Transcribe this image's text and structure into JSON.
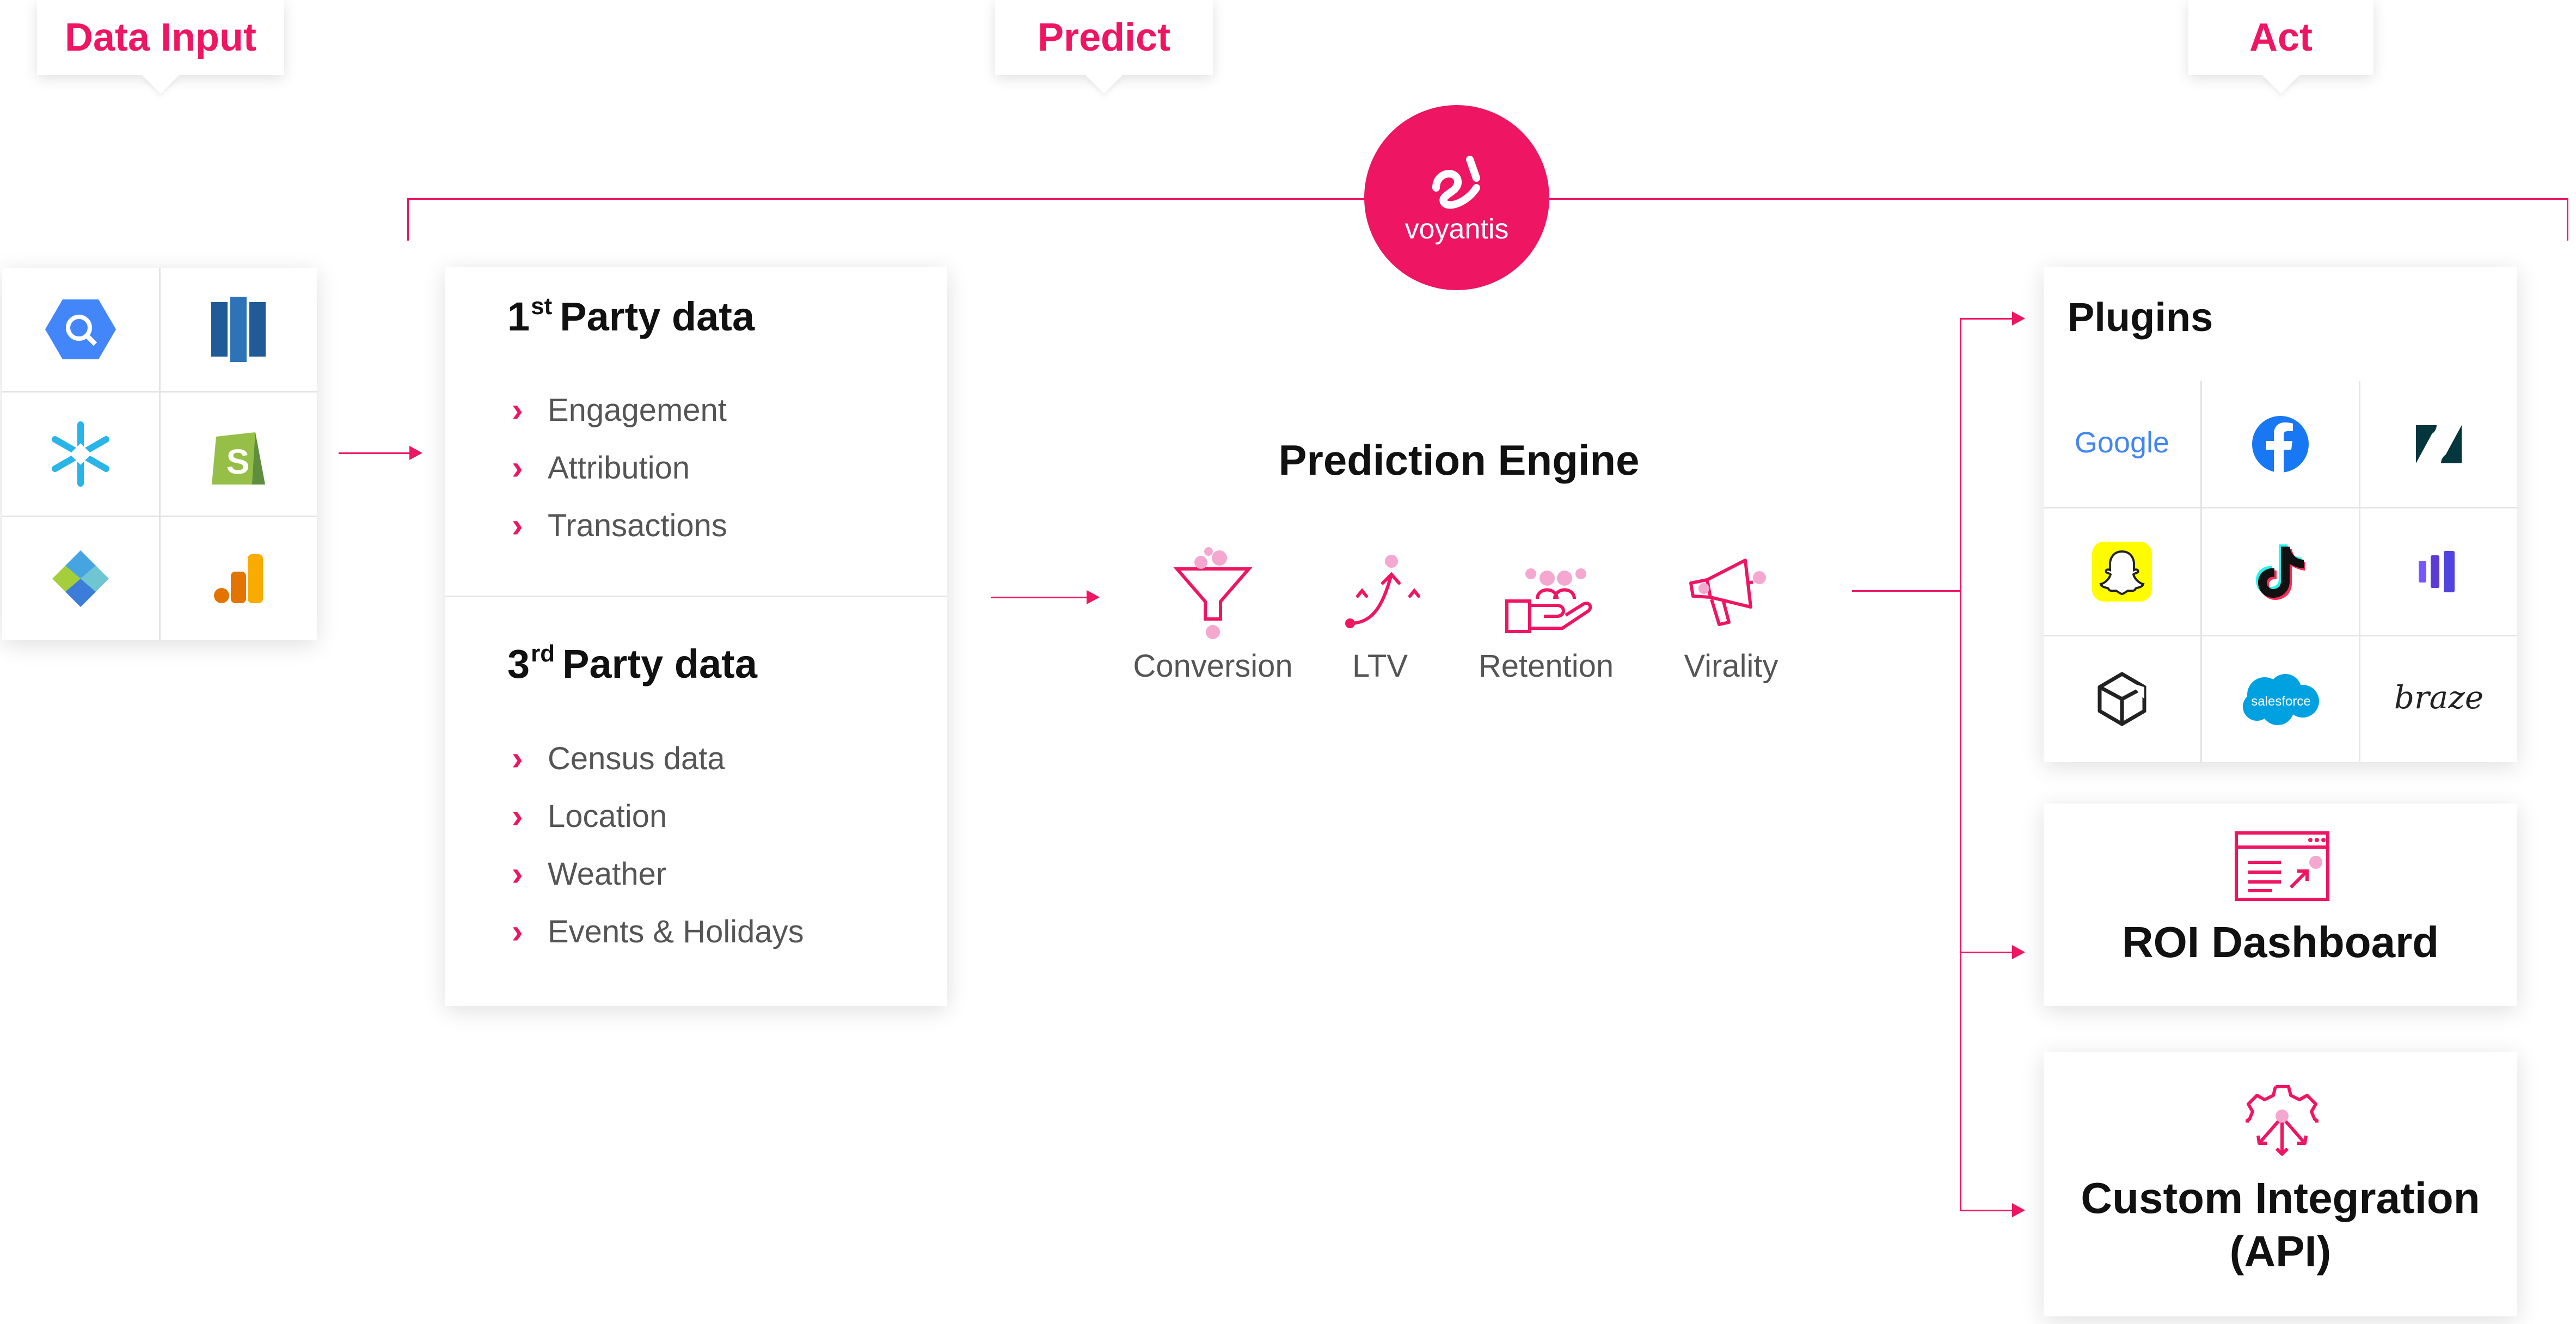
{
  "stages": {
    "data_input": "Data Input",
    "predict": "Predict",
    "act": "Act"
  },
  "logo": {
    "text": "voyantis",
    "mark": "ℯ"
  },
  "data_sources": [
    "bigquery-icon",
    "redshift-icon",
    "snowflake-icon",
    "shopify-icon",
    "segment-icon",
    "google-analytics-icon"
  ],
  "first_party": {
    "num": "1",
    "sup": "st",
    "title": "Party data",
    "items": [
      "Engagement",
      "Attribution",
      "Transactions"
    ]
  },
  "third_party": {
    "num": "3",
    "sup": "rd",
    "title": "Party data",
    "items": [
      "Census data",
      "Location",
      "Weather",
      "Events & Holidays"
    ]
  },
  "engine": {
    "title": "Prediction Engine",
    "items": [
      "Conversion",
      "LTV",
      "Retention",
      "Virality"
    ]
  },
  "plugins": {
    "title": "Plugins",
    "google_text": "Google",
    "salesforce_text": "salesforce",
    "braze_text": "braze",
    "icons": [
      "google-icon",
      "facebook-icon",
      "zendesk-icon",
      "snapchat-icon",
      "tiktok-icon",
      "mixpanel-icon",
      "unity-icon",
      "salesforce-icon",
      "braze-icon"
    ]
  },
  "roi": {
    "title": "ROI Dashboard"
  },
  "custom": {
    "line1": "Custom Integration",
    "line2": "(API)"
  },
  "colors": {
    "accent": "#ee1563",
    "text": "#111111",
    "muted": "#555555"
  }
}
